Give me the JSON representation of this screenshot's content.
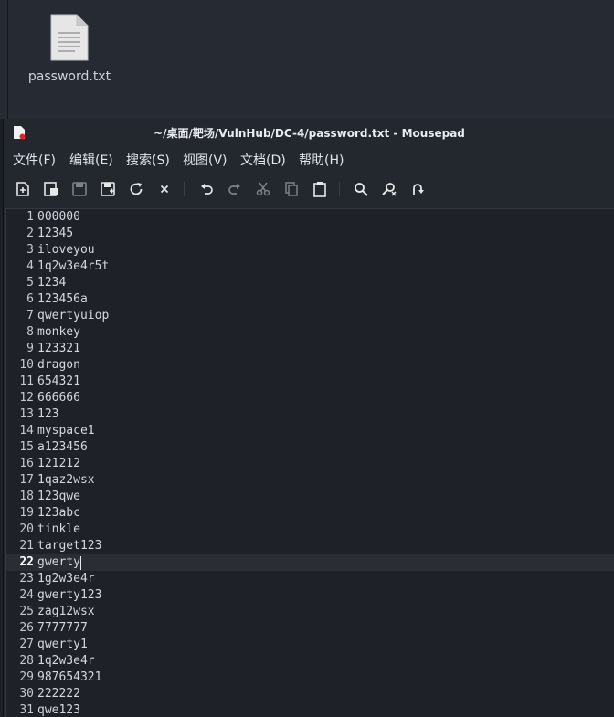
{
  "desktop": {
    "file_label": "password.txt"
  },
  "window": {
    "title": "~/桌面/靶场/VulnHub/DC-4/password.txt - Mousepad"
  },
  "menu": [
    "文件(F)",
    "编辑(E)",
    "搜索(S)",
    "视图(V)",
    "文档(D)",
    "帮助(H)"
  ],
  "toolbar": [
    {
      "icon": "new-document-icon"
    },
    {
      "icon": "new-window-icon"
    },
    {
      "icon": "save-icon"
    },
    {
      "icon": "save-as-icon"
    },
    {
      "icon": "reload-icon"
    },
    {
      "icon": "close-icon"
    },
    {
      "icon": "undo-icon"
    },
    {
      "icon": "redo-icon"
    },
    {
      "icon": "cut-icon"
    },
    {
      "icon": "copy-icon"
    },
    {
      "icon": "paste-icon"
    },
    {
      "icon": "find-icon"
    },
    {
      "icon": "find-replace-icon"
    },
    {
      "icon": "goto-line-icon"
    }
  ],
  "editor": {
    "current_line": 22,
    "lines": [
      {
        "n": "1",
        "text": "000000"
      },
      {
        "n": "2",
        "text": "12345"
      },
      {
        "n": "3",
        "text": "iloveyou"
      },
      {
        "n": "4",
        "text": "1q2w3e4r5t"
      },
      {
        "n": "5",
        "text": "1234"
      },
      {
        "n": "6",
        "text": "123456a"
      },
      {
        "n": "7",
        "text": "qwertyuiop"
      },
      {
        "n": "8",
        "text": "monkey"
      },
      {
        "n": "9",
        "text": "123321"
      },
      {
        "n": "10",
        "text": "dragon"
      },
      {
        "n": "11",
        "text": "654321"
      },
      {
        "n": "12",
        "text": "666666"
      },
      {
        "n": "13",
        "text": "123"
      },
      {
        "n": "14",
        "text": "myspace1"
      },
      {
        "n": "15",
        "text": "a123456"
      },
      {
        "n": "16",
        "text": "121212"
      },
      {
        "n": "17",
        "text": "1qaz2wsx"
      },
      {
        "n": "18",
        "text": "123qwe"
      },
      {
        "n": "19",
        "text": "123abc"
      },
      {
        "n": "20",
        "text": "tinkle"
      },
      {
        "n": "21",
        "text": "target123"
      },
      {
        "n": "22",
        "text": "gwerty"
      },
      {
        "n": "23",
        "text": "1g2w3e4r"
      },
      {
        "n": "24",
        "text": "gwerty123"
      },
      {
        "n": "25",
        "text": "zag12wsx"
      },
      {
        "n": "26",
        "text": "7777777"
      },
      {
        "n": "27",
        "text": "qwerty1"
      },
      {
        "n": "28",
        "text": "1q2w3e4r"
      },
      {
        "n": "29",
        "text": "987654321"
      },
      {
        "n": "30",
        "text": "222222"
      },
      {
        "n": "31",
        "text": "qwe123"
      }
    ]
  }
}
